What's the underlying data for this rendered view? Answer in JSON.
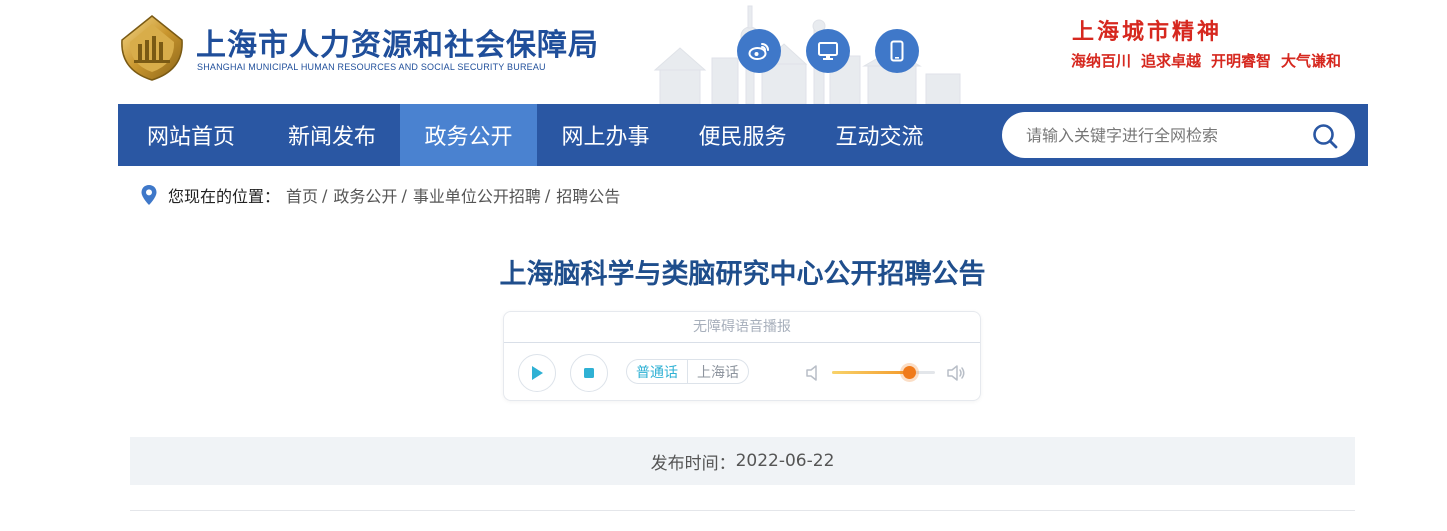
{
  "header": {
    "site_title": "上海市人力资源和社会保障局",
    "site_subtitle": "SHANGHAI MUNICIPAL HUMAN RESOURCES AND SOCIAL SECURITY BUREAU",
    "social_icons": [
      "weibo-icon",
      "desktop-icon",
      "mobile-icon"
    ],
    "spirit_title": "上海城市精神",
    "spirit_slogans": [
      "海纳百川",
      "追求卓越",
      "开明睿智",
      "大气谦和"
    ]
  },
  "nav": {
    "items": [
      {
        "label": "网站首页",
        "active": false
      },
      {
        "label": "新闻发布",
        "active": false
      },
      {
        "label": "政务公开",
        "active": true
      },
      {
        "label": "网上办事",
        "active": false
      },
      {
        "label": "便民服务",
        "active": false
      },
      {
        "label": "互动交流",
        "active": false
      }
    ],
    "search_placeholder": "请输入关键字进行全网检索"
  },
  "breadcrumb": {
    "label": "您现在的位置：",
    "items": [
      "首页",
      "政务公开",
      "事业单位公开招聘",
      "招聘公告"
    ],
    "separator": "/"
  },
  "article": {
    "title": "上海脑科学与类脑研究中心公开招聘公告",
    "publish_label": "发布时间：",
    "publish_date": "2022-06-22"
  },
  "player": {
    "title": "无障碍语音播报",
    "languages": [
      "普通话",
      "上海话"
    ],
    "selected_language": "普通话",
    "volume": 0.75
  },
  "colors": {
    "brand_blue": "#2a57a3",
    "nav_active": "#4a82d0",
    "title_blue": "#1f4e8c",
    "spirit_red": "#d6281f",
    "accent_cyan": "#2fb1d4",
    "volume_orange": "#f07a1a"
  }
}
